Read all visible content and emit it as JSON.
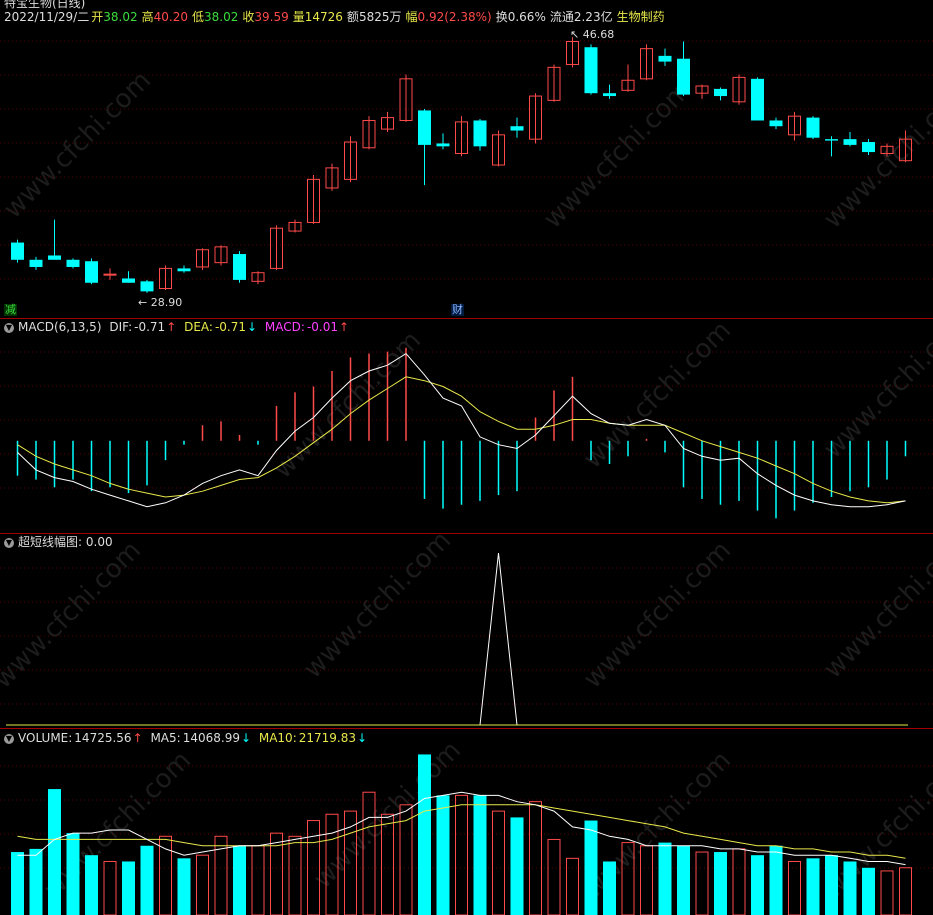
{
  "header": {
    "stock_name": "特宝生物(日线)",
    "date": "2022/11/29/二",
    "open_label": "开",
    "open": "38.02",
    "high_label": "高",
    "high": "40.20",
    "low_label": "低",
    "low": "38.02",
    "close_label": "收",
    "close": "39.59",
    "volume_label": "量",
    "volume": "14726",
    "amount_label": "额",
    "amount": "5825万",
    "change_label": "幅",
    "change": "0.92(2.38%)",
    "turnover_label": "换",
    "turnover": "0.66%",
    "float_label": "流通",
    "float": "2.23亿",
    "sector": "生物制药"
  },
  "price_panel": {
    "high_marker": "46.68",
    "low_marker": "28.90",
    "tag_reduce": "减",
    "tag_finance": "财"
  },
  "macd_panel": {
    "title": "MACD(6,13,5)",
    "dif_label": "DIF:",
    "dif": "-0.71",
    "dea_label": "DEA:",
    "dea": "-0.71",
    "macd_label": "MACD:",
    "macd": "-0.01"
  },
  "short_panel": {
    "title": "超短线幅图",
    "value": ": 0.00"
  },
  "volume_panel": {
    "title": "VOLUME:",
    "volume": "14725.56",
    "ma5_label": "MA5:",
    "ma5": "14068.99",
    "ma10_label": "MA10:",
    "ma10": "21719.83"
  },
  "watermark": "www.cfchi.com",
  "colors": {
    "up": "#ff4a4a",
    "down": "#00ffff",
    "yellow": "#e8e84a",
    "white": "#ffffff",
    "magenta": "#ff40ff",
    "green": "#3ddc3d"
  },
  "candles": [
    {
      "o": 32.4,
      "h": 32.6,
      "l": 31.0,
      "c": 31.2
    },
    {
      "o": 31.2,
      "h": 31.4,
      "l": 30.5,
      "c": 30.7
    },
    {
      "o": 31.5,
      "h": 34.0,
      "l": 31.2,
      "c": 31.2
    },
    {
      "o": 31.2,
      "h": 31.3,
      "l": 30.6,
      "c": 30.7
    },
    {
      "o": 31.1,
      "h": 31.3,
      "l": 29.5,
      "c": 29.6
    },
    {
      "o": 30.2,
      "h": 30.6,
      "l": 29.8,
      "c": 30.2
    },
    {
      "o": 29.9,
      "h": 30.4,
      "l": 29.6,
      "c": 29.6
    },
    {
      "o": 29.7,
      "h": 29.8,
      "l": 28.9,
      "c": 29.0
    },
    {
      "o": 29.2,
      "h": 30.8,
      "l": 29.1,
      "c": 30.6
    },
    {
      "o": 30.6,
      "h": 30.8,
      "l": 30.3,
      "c": 30.4
    },
    {
      "o": 30.7,
      "h": 32.0,
      "l": 30.5,
      "c": 31.9
    },
    {
      "o": 31.0,
      "h": 32.2,
      "l": 30.8,
      "c": 32.1
    },
    {
      "o": 31.6,
      "h": 31.8,
      "l": 29.6,
      "c": 29.8
    },
    {
      "o": 29.7,
      "h": 30.4,
      "l": 29.5,
      "c": 30.3
    },
    {
      "o": 30.6,
      "h": 33.6,
      "l": 30.5,
      "c": 33.4
    },
    {
      "o": 33.2,
      "h": 34.0,
      "l": 33.1,
      "c": 33.8
    },
    {
      "o": 33.8,
      "h": 37.1,
      "l": 33.7,
      "c": 36.8
    },
    {
      "o": 36.2,
      "h": 37.9,
      "l": 36.0,
      "c": 37.6
    },
    {
      "o": 36.8,
      "h": 39.8,
      "l": 36.6,
      "c": 39.4
    },
    {
      "o": 39.0,
      "h": 41.2,
      "l": 38.9,
      "c": 40.9
    },
    {
      "o": 40.3,
      "h": 41.5,
      "l": 40.1,
      "c": 41.1
    },
    {
      "o": 40.9,
      "h": 44.1,
      "l": 40.8,
      "c": 43.8
    },
    {
      "o": 41.6,
      "h": 41.7,
      "l": 36.4,
      "c": 39.2
    },
    {
      "o": 39.3,
      "h": 40.0,
      "l": 38.9,
      "c": 39.1
    },
    {
      "o": 38.6,
      "h": 41.2,
      "l": 38.4,
      "c": 40.8
    },
    {
      "o": 40.9,
      "h": 41.0,
      "l": 38.8,
      "c": 39.1
    },
    {
      "o": 37.8,
      "h": 40.2,
      "l": 37.7,
      "c": 39.9
    },
    {
      "o": 40.5,
      "h": 41.1,
      "l": 39.7,
      "c": 40.2
    },
    {
      "o": 39.6,
      "h": 42.8,
      "l": 39.3,
      "c": 42.6
    },
    {
      "o": 42.3,
      "h": 44.8,
      "l": 42.2,
      "c": 44.6
    },
    {
      "o": 44.8,
      "h": 46.7,
      "l": 44.6,
      "c": 46.4
    },
    {
      "o": 46.0,
      "h": 46.2,
      "l": 42.7,
      "c": 42.8
    },
    {
      "o": 42.8,
      "h": 43.4,
      "l": 42.4,
      "c": 42.6
    },
    {
      "o": 43.0,
      "h": 44.8,
      "l": 42.9,
      "c": 43.7
    },
    {
      "o": 43.8,
      "h": 46.2,
      "l": 43.7,
      "c": 45.9
    },
    {
      "o": 45.4,
      "h": 45.9,
      "l": 44.7,
      "c": 45.0
    },
    {
      "o": 45.2,
      "h": 46.4,
      "l": 42.6,
      "c": 42.7
    },
    {
      "o": 42.8,
      "h": 43.4,
      "l": 42.4,
      "c": 43.3
    },
    {
      "o": 43.1,
      "h": 43.2,
      "l": 42.3,
      "c": 42.6
    },
    {
      "o": 42.2,
      "h": 44.1,
      "l": 42.0,
      "c": 43.9
    },
    {
      "o": 43.8,
      "h": 43.9,
      "l": 40.9,
      "c": 40.9
    },
    {
      "o": 40.9,
      "h": 41.1,
      "l": 40.3,
      "c": 40.5
    },
    {
      "o": 39.9,
      "h": 41.5,
      "l": 39.5,
      "c": 41.2
    },
    {
      "o": 41.1,
      "h": 41.2,
      "l": 39.6,
      "c": 39.7
    },
    {
      "o": 39.6,
      "h": 39.8,
      "l": 38.4,
      "c": 39.5
    },
    {
      "o": 39.6,
      "h": 40.1,
      "l": 39.1,
      "c": 39.2
    },
    {
      "o": 39.4,
      "h": 39.6,
      "l": 38.5,
      "c": 38.7
    },
    {
      "o": 38.6,
      "h": 39.3,
      "l": 38.4,
      "c": 39.1
    },
    {
      "o": 38.1,
      "h": 40.2,
      "l": 38.0,
      "c": 39.6
    }
  ],
  "macd_dif": [
    -0.6,
    -1.5,
    -1.9,
    -2.1,
    -2.5,
    -2.8,
    -3.1,
    -3.4,
    -3.2,
    -2.8,
    -2.2,
    -1.8,
    -1.5,
    -1.8,
    -0.5,
    0.5,
    1.2,
    2.2,
    3.1,
    3.6,
    3.9,
    4.5,
    3.4,
    2.2,
    1.8,
    0.2,
    -0.2,
    -0.4,
    0.3,
    1.3,
    2.3,
    1.4,
    0.9,
    0.8,
    1.1,
    0.8,
    -0.4,
    -0.8,
    -1.0,
    -0.9,
    -1.7,
    -2.3,
    -2.8,
    -3.1,
    -3.3,
    -3.4,
    -3.4,
    -3.3,
    -3.1
  ],
  "macd_dea": [
    -0.2,
    -0.8,
    -1.2,
    -1.5,
    -1.8,
    -2.2,
    -2.5,
    -2.7,
    -2.9,
    -2.8,
    -2.6,
    -2.3,
    -2.0,
    -1.9,
    -1.4,
    -0.8,
    -0.1,
    0.6,
    1.4,
    2.1,
    2.7,
    3.3,
    3.1,
    2.8,
    2.3,
    1.5,
    1.0,
    0.6,
    0.6,
    0.8,
    1.1,
    1.1,
    0.9,
    0.8,
    0.8,
    0.8,
    0.4,
    0.0,
    -0.3,
    -0.6,
    -0.9,
    -1.3,
    -1.7,
    -2.2,
    -2.6,
    -2.9,
    -3.1,
    -3.2,
    -3.1
  ],
  "macd_hist": [
    -1.8,
    -2.0,
    -2.4,
    -2.0,
    -2.6,
    -2.4,
    -2.7,
    -2.3,
    -1.0,
    -0.2,
    0.8,
    1.0,
    0.3,
    -0.2,
    1.8,
    2.5,
    2.8,
    3.6,
    4.3,
    4.5,
    4.6,
    4.8,
    -3.0,
    -3.5,
    -3.3,
    -3.1,
    -2.8,
    -2.6,
    1.2,
    2.6,
    3.3,
    -1.0,
    -1.2,
    -0.8,
    0.1,
    -0.6,
    -2.4,
    -3.0,
    -3.3,
    -3.1,
    -3.6,
    -4.0,
    -3.6,
    -3.2,
    -2.9,
    -2.6,
    -2.4,
    -2.0,
    -0.8
  ],
  "short_line": [
    0,
    0,
    0,
    0,
    0,
    0,
    0,
    0,
    0,
    0,
    0,
    0,
    0,
    0,
    0,
    0,
    0,
    0,
    0,
    0,
    0,
    0,
    0,
    0,
    0,
    0,
    1,
    0,
    0,
    0,
    0,
    0,
    0,
    0,
    0,
    0,
    0,
    0,
    0,
    0,
    0,
    0,
    0,
    0,
    0,
    0,
    0,
    0,
    0
  ],
  "volumes": [
    20,
    21,
    40,
    26,
    19,
    17,
    17,
    22,
    25,
    18,
    19,
    25,
    22,
    22,
    26,
    25,
    30,
    32,
    33,
    39,
    32,
    35,
    51,
    38,
    38,
    38,
    33,
    31,
    36,
    24,
    18,
    30,
    17,
    23,
    22,
    23,
    22,
    20,
    20,
    21,
    19,
    22,
    17,
    18,
    19,
    17,
    15,
    14,
    15
  ],
  "vol_ma5": [
    19,
    19,
    24,
    26,
    26,
    27,
    27,
    24,
    21,
    19,
    20,
    21,
    22,
    22,
    23,
    24,
    25,
    26,
    28,
    31,
    31,
    33,
    37,
    38,
    39,
    38,
    38,
    36,
    35,
    33,
    28,
    27,
    25,
    24,
    22,
    22,
    22,
    22,
    21,
    21,
    20,
    20,
    19,
    19,
    19,
    18,
    17,
    17,
    16
  ],
  "vol_ma10": [
    25,
    24,
    24,
    24,
    24,
    24,
    24,
    24,
    24,
    23,
    22,
    22,
    22,
    22,
    22,
    23,
    23,
    24,
    26,
    28,
    29,
    30,
    33,
    34,
    35,
    35,
    35,
    35,
    35,
    34,
    33,
    32,
    31,
    30,
    29,
    28,
    26,
    25,
    24,
    23,
    22,
    22,
    21,
    21,
    20,
    20,
    19,
    19,
    18
  ]
}
